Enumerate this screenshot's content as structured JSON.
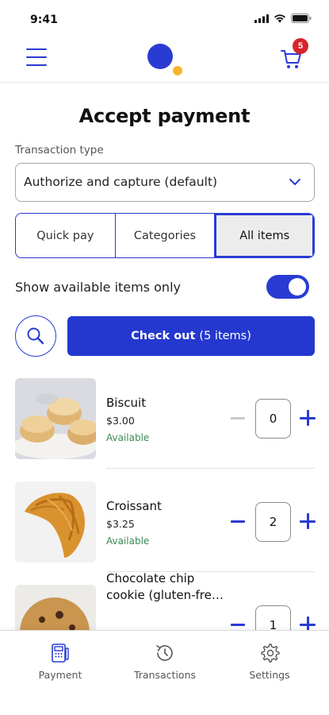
{
  "status_bar": {
    "time": "9:41"
  },
  "header": {
    "cart_count": "5"
  },
  "page": {
    "title": "Accept payment"
  },
  "transaction_type": {
    "label": "Transaction type",
    "selected": "Authorize and capture (default)"
  },
  "tabs": [
    {
      "label": "Quick pay",
      "active": false
    },
    {
      "label": "Categories",
      "active": false
    },
    {
      "label": "All items",
      "active": true
    }
  ],
  "filter": {
    "label": "Show available items only",
    "enabled": true
  },
  "checkout": {
    "label": "Check out",
    "count_text": "(5 items)"
  },
  "items": [
    {
      "name": "Biscuit",
      "price": "$3.00",
      "status": "Available",
      "quantity": "0"
    },
    {
      "name": "Croissant",
      "price": "$3.25",
      "status": "Available",
      "quantity": "2"
    },
    {
      "name": "Chocolate chip cookie (gluten-fre…",
      "quantity": "1"
    }
  ],
  "bottom_nav": [
    {
      "label": "Payment",
      "icon": "payment-terminal-icon"
    },
    {
      "label": "Transactions",
      "icon": "clock-history-icon"
    },
    {
      "label": "Settings",
      "icon": "gear-icon"
    }
  ],
  "colors": {
    "accent": "#2a3bd3",
    "available_text": "#3a8a52",
    "badge": "#d8232a",
    "logo_yellow": "#f6b52c"
  }
}
